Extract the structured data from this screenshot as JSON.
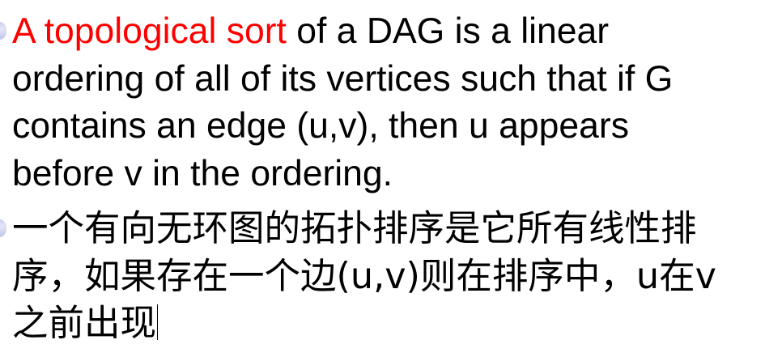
{
  "bullets": [
    {
      "lead": "A topological sort",
      "lines": [
        " of a DAG is a linear",
        "ordering of all of its vertices such that if G",
        "contains an edge (u,v), then u appears",
        "before v in the ordering."
      ]
    },
    {
      "lines": [
        "一个有向无环图的拓扑排序是它所有线性排",
        "序，如果存在一个边(u,v)则在排序中，u在v",
        "之前出现"
      ]
    }
  ],
  "colors": {
    "highlight": "#ff0000",
    "text": "#000000",
    "bullet": "#c9cdec"
  }
}
